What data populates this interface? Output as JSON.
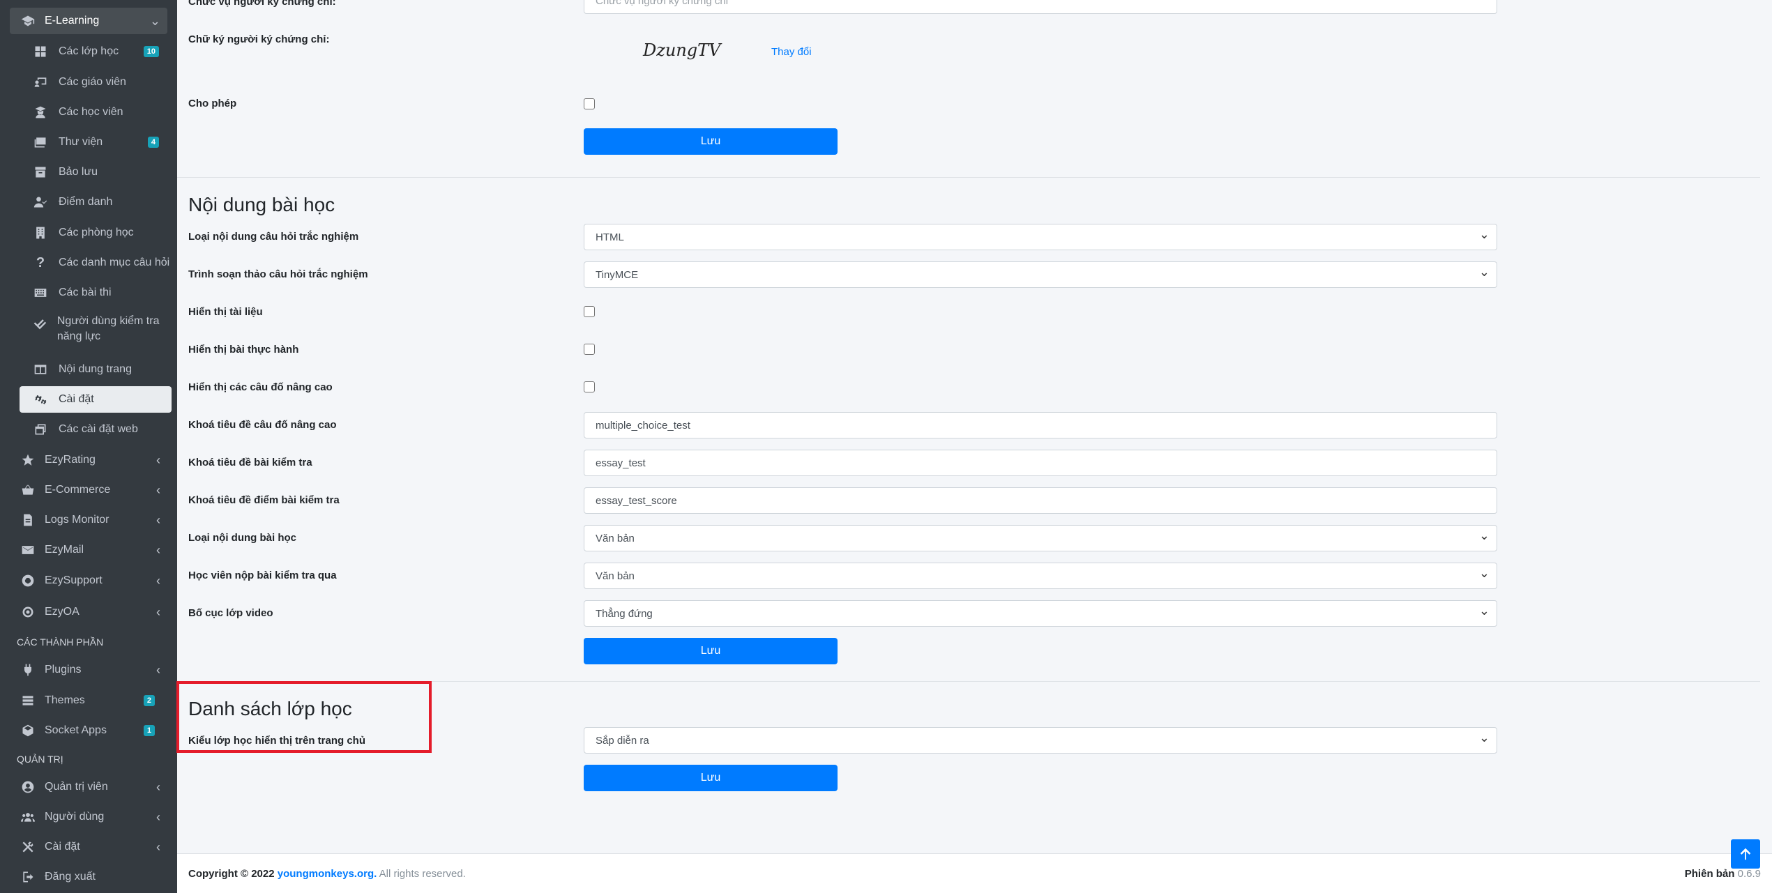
{
  "sidebar": {
    "elearning": {
      "label": "E-Learning"
    },
    "sub": [
      {
        "label": "Các lớp học",
        "badge": "10"
      },
      {
        "label": "Các giáo viên"
      },
      {
        "label": "Các học viên"
      },
      {
        "label": "Thư viện",
        "badge": "4"
      },
      {
        "label": "Bảo lưu"
      },
      {
        "label": "Điểm danh"
      },
      {
        "label": "Các phòng học"
      },
      {
        "label": "Các danh mục câu hỏi"
      },
      {
        "label": "Các bài thi"
      },
      {
        "label": "Người dùng kiểm tra năng lực"
      },
      {
        "label": "Nội dung trang"
      },
      {
        "label": "Cài đặt"
      },
      {
        "label": "Các cài đặt web"
      }
    ],
    "apps": [
      {
        "label": "EzyRating"
      },
      {
        "label": "E-Commerce"
      },
      {
        "label": "Logs Monitor"
      },
      {
        "label": "EzyMail"
      },
      {
        "label": "EzySupport"
      },
      {
        "label": "EzyOA"
      }
    ],
    "header_components": "CÁC THÀNH PHẦN",
    "components": [
      {
        "label": "Plugins"
      },
      {
        "label": "Themes",
        "badge": "2"
      },
      {
        "label": "Socket Apps",
        "badge": "1"
      }
    ],
    "header_admin": "QUẢN TRỊ",
    "admin": [
      {
        "label": "Quản trị viên"
      },
      {
        "label": "Người dùng"
      },
      {
        "label": "Cài đặt"
      },
      {
        "label": "Đăng xuất"
      }
    ]
  },
  "certificate": {
    "signer_position_label": "Chức vụ người ký chứng chỉ:",
    "signer_position_placeholder": "Chức vụ người ký chứng chỉ",
    "signature_label": "Chữ ký người ký chứng chỉ:",
    "signature_text": "DzungTV",
    "change_link": "Thay đổi",
    "allow_label": "Cho phép",
    "save": "Lưu"
  },
  "lesson_content": {
    "title": "Nội dung bài học",
    "rows": [
      {
        "label": "Loại nội dung câu hỏi trắc nghiệm",
        "type": "select",
        "value": "HTML"
      },
      {
        "label": "Trình soạn thảo câu hỏi trắc nghiệm",
        "type": "select",
        "value": "TinyMCE"
      },
      {
        "label": "Hiển thị tài liệu",
        "type": "checkbox"
      },
      {
        "label": "Hiển thị bài thực hành",
        "type": "checkbox"
      },
      {
        "label": "Hiển thị các câu đố nâng cao",
        "type": "checkbox"
      },
      {
        "label": "Khoá tiêu đề câu đố nâng cao",
        "type": "text",
        "value": "multiple_choice_test"
      },
      {
        "label": "Khoá tiêu đề bài kiểm tra",
        "type": "text",
        "value": "essay_test"
      },
      {
        "label": "Khoá tiêu đề điểm bài kiểm tra",
        "type": "text",
        "value": "essay_test_score"
      },
      {
        "label": "Loại nội dung bài học",
        "type": "select",
        "value": "Văn bản"
      },
      {
        "label": "Học viên nộp bài kiểm tra qua",
        "type": "select",
        "value": "Văn bản"
      },
      {
        "label": "Bố cục lớp video",
        "type": "select",
        "value": "Thẳng đứng"
      }
    ],
    "save": "Lưu"
  },
  "class_list": {
    "title": "Danh sách lớp học",
    "display_label": "Kiểu lớp học hiển thị trên trang chủ",
    "display_value": "Sắp diễn ra",
    "save": "Lưu"
  },
  "footer": {
    "copyright": "Copyright © 2022",
    "site": "youngmonkeys.org.",
    "rights": "All rights reserved.",
    "version_label": "Phiên bản",
    "version": "0.6.9"
  },
  "colors": {
    "sidebar": "#343a40",
    "primary": "#007bff",
    "badge": "#17a2b8",
    "highlight": "#e41c2b"
  }
}
